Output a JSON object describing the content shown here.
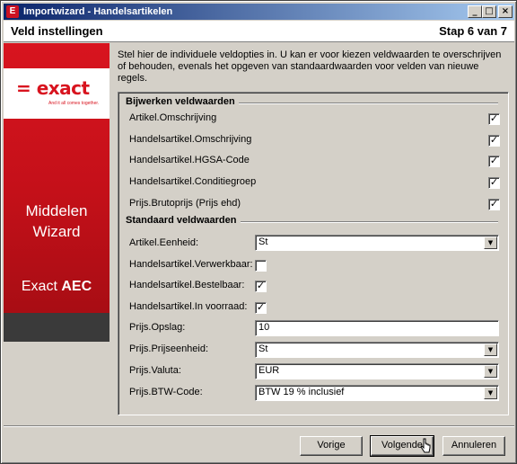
{
  "window": {
    "title": "Importwizard - Handelsartikelen",
    "app_icon": "E",
    "controls": {
      "minimize": "_",
      "maximize": "□",
      "close": "×"
    }
  },
  "header": {
    "title": "Veld instellingen",
    "step": "Stap 6 van 7"
  },
  "sidebar": {
    "logo": "= exact",
    "tagline": "And it all comes together.",
    "wizard_line1": "Middelen",
    "wizard_line2": "Wizard",
    "product_prefix": "Exact",
    "product_bold": "AEC",
    "colors": {
      "red": "#d8141f",
      "dark": "#3a3a3a"
    }
  },
  "intro_text": "Stel hier de individuele veldopties in. U kan er voor kiezen veldwaarden te overschrijven of behouden, evenals het opgeven van standaardwaarden voor velden van nieuwe regels.",
  "update_group": {
    "title": "Bijwerken veldwaarden",
    "rows": [
      {
        "label": "Artikel.Omschrijving",
        "checked": "✓"
      },
      {
        "label": "Handelsartikel.Omschrijving",
        "checked": "✓"
      },
      {
        "label": "Handelsartikel.HGSA-Code",
        "checked": "✓"
      },
      {
        "label": "Handelsartikel.Conditiegroep",
        "checked": "✓"
      },
      {
        "label": "Prijs.Brutoprijs (Prijs ehd)",
        "checked": "✓"
      }
    ]
  },
  "default_group": {
    "title": "Standaard veldwaarden",
    "eenheid": {
      "label": "Artikel.Eenheid:",
      "value": "St"
    },
    "verwerkbaar": {
      "label": "Handelsartikel.Verwerkbaar:",
      "checked": ""
    },
    "bestelbaar": {
      "label": "Handelsartikel.Bestelbaar:",
      "checked": "✓"
    },
    "voorraad": {
      "label": "Handelsartikel.In voorraad:",
      "checked": "✓"
    },
    "opslag": {
      "label": "Prijs.Opslag:",
      "value": "10"
    },
    "prijseenheid": {
      "label": "Prijs.Prijseenheid:",
      "value": "St"
    },
    "valuta": {
      "label": "Prijs.Valuta:",
      "value": "EUR"
    },
    "btw": {
      "label": "Prijs.BTW-Code:",
      "value": "BTW 19 % inclusief"
    }
  },
  "buttons": {
    "previous": "Vorige",
    "next": "Volgende",
    "cancel": "Annuleren"
  }
}
